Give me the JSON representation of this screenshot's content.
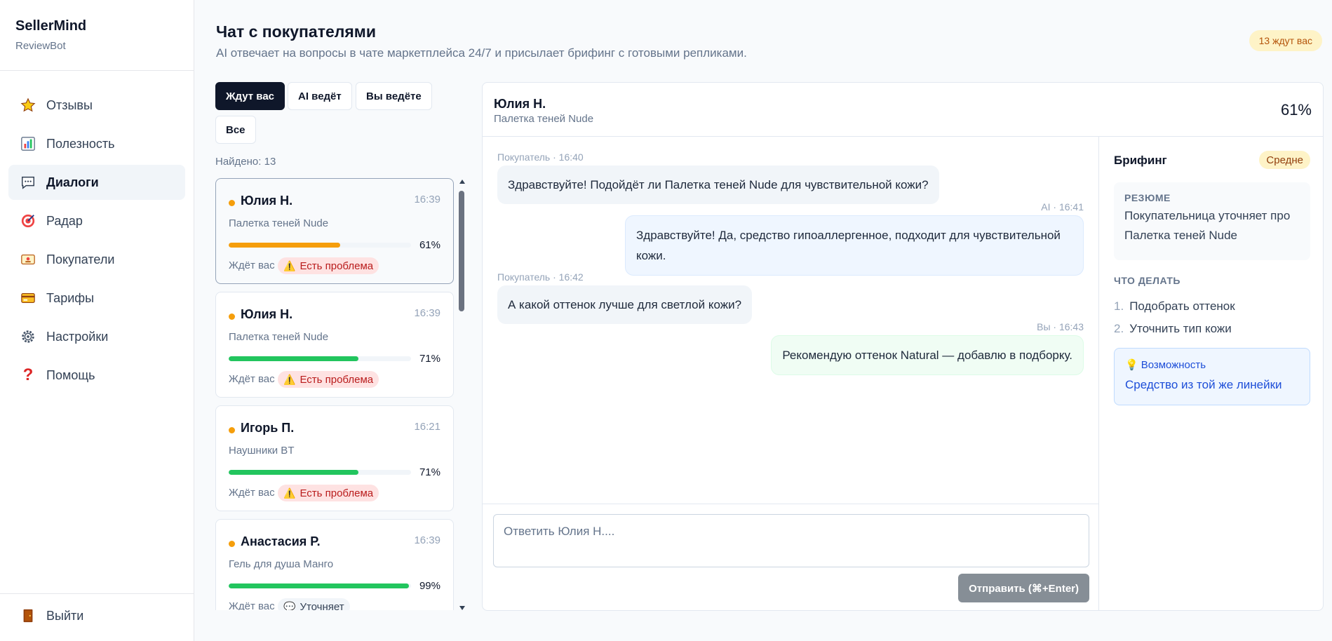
{
  "brand": {
    "name": "SellerMind",
    "subtitle": "ReviewBot"
  },
  "nav": [
    {
      "label": "Отзывы",
      "icon": "star-icon"
    },
    {
      "label": "Полезность",
      "icon": "bar-chart-icon"
    },
    {
      "label": "Диалоги",
      "icon": "chat-icon",
      "active": true
    },
    {
      "label": "Радар",
      "icon": "target-icon"
    },
    {
      "label": "Покупатели",
      "icon": "id-card-icon"
    },
    {
      "label": "Тарифы",
      "icon": "credit-card-icon"
    },
    {
      "label": "Настройки",
      "icon": "gear-icon"
    },
    {
      "label": "Помощь",
      "icon": "question-icon"
    }
  ],
  "logout": {
    "label": "Выйти",
    "icon": "door-icon"
  },
  "header": {
    "title": "Чат с покупателями",
    "subtitle": "AI отвечает на вопросы в чате маркетплейса 24/7 и присылает брифинг с готовыми репликами.",
    "waiting_badge": "13 ждут вас"
  },
  "filters": [
    {
      "label": "Ждут вас",
      "active": true
    },
    {
      "label": "AI ведёт",
      "active": false
    },
    {
      "label": "Вы ведёте",
      "active": false
    },
    {
      "label": "Все",
      "active": false
    }
  ],
  "found": "Найдено: 13",
  "conversations": [
    {
      "name": "Юлия Н.",
      "time": "16:39",
      "product": "Палетка теней Nude",
      "score": 0.61,
      "score_label": "61%",
      "status": "Ждёт вас",
      "tag": "Есть проблема",
      "tag_type": "problem",
      "selected": true
    },
    {
      "name": "Юлия Н.",
      "time": "16:39",
      "product": "Палетка теней Nude",
      "score": 0.71,
      "score_label": "71%",
      "status": "Ждёт вас",
      "tag": "Есть проблема",
      "tag_type": "problem",
      "selected": false
    },
    {
      "name": "Игорь П.",
      "time": "16:21",
      "product": "Наушники BT",
      "score": 0.71,
      "score_label": "71%",
      "status": "Ждёт вас",
      "tag": "Есть проблема",
      "tag_type": "problem",
      "selected": false
    },
    {
      "name": "Анастасия Р.",
      "time": "16:39",
      "product": "Гель для душа Манго",
      "score": 0.99,
      "score_label": "99%",
      "status": "Ждёт вас",
      "tag": "Уточняет",
      "tag_type": "clarify",
      "selected": false
    }
  ],
  "colors": {
    "bar_warning": "#f59e0b",
    "bar_ok": "#22c55e"
  },
  "chat": {
    "name": "Юлия Н.",
    "product": "Палетка теней Nude",
    "score": "61%",
    "messages": [
      {
        "meta": "Покупатель · 16:40",
        "text": "Здравствуйте! Подойдёт ли Палетка теней Nude для чувствительной кожи?",
        "from": "customer"
      },
      {
        "meta": "AI · 16:41",
        "text": "Здравствуйте! Да, средство гипоаллергенное, подходит для чувствительной кожи.",
        "from": "ai"
      },
      {
        "meta": "Покупатель · 16:42",
        "text": "А какой оттенок лучше для светлой кожи?",
        "from": "customer"
      },
      {
        "meta": "Вы · 16:43",
        "text": "Рекомендую оттенок Natural — добавлю в подборку.",
        "from": "you"
      }
    ],
    "reply_placeholder": "Ответить Юлия Н....",
    "send_label": "Отправить (⌘+Enter)"
  },
  "briefing": {
    "title": "Брифинг",
    "level": "Средне",
    "summary_label": "РЕЗЮМЕ",
    "summary": "Покупательница уточняет про Палетка теней Nude",
    "todo_label": "ЧТО ДЕЛАТЬ",
    "todos": [
      "Подобрать оттенок",
      "Уточнить тип кожи"
    ],
    "opportunity_label": "Возможность",
    "opportunity": "Средство из той же линейки"
  }
}
